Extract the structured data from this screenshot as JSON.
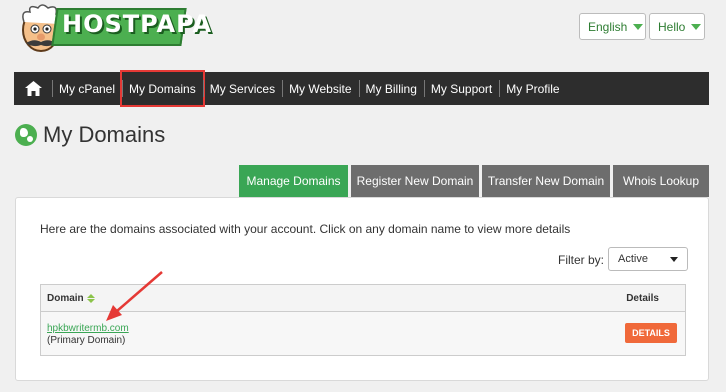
{
  "brand": {
    "name": "HOSTPAPA",
    "primary_color": "#4caf50",
    "accent_color": "#f0693a"
  },
  "header": {
    "language": "English",
    "user_menu": "Hello"
  },
  "nav": {
    "home_icon": "home-icon",
    "items": [
      "My cPanel",
      "My Domains",
      "My Services",
      "My Website",
      "My Billing",
      "My Support",
      "My Profile"
    ],
    "highlighted": "My Domains"
  },
  "page": {
    "title": "My Domains",
    "title_icon": "globe-icon"
  },
  "tabs": [
    "Manage Domains",
    "Register New Domain",
    "Transfer New Domain",
    "Whois Lookup"
  ],
  "active_tab": "Manage Domains",
  "panel": {
    "info": "Here are the domains associated with your account. Click on any domain name to view more details",
    "filter_label": "Filter by:",
    "filter_value": "Active"
  },
  "table": {
    "headers": {
      "domain": "Domain",
      "details": "Details"
    },
    "rows": [
      {
        "domain": "hpkbwritermb.com",
        "note": "(Primary Domain)",
        "action": "DETAILS"
      }
    ]
  }
}
